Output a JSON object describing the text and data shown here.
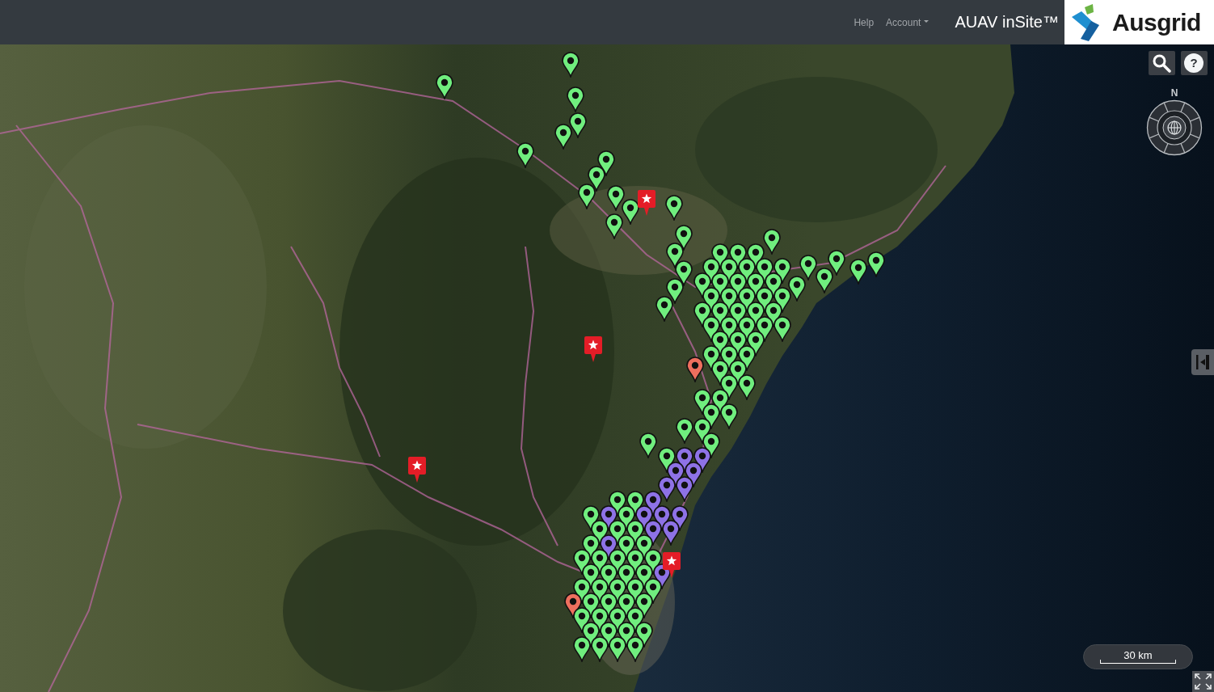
{
  "header": {
    "nav": [
      {
        "label": "Help",
        "kind": "link"
      },
      {
        "label": "Account",
        "kind": "dropdown"
      }
    ],
    "title": "AUAV inSite™",
    "logo": {
      "text": "Ausgrid"
    }
  },
  "map_controls": {
    "help_button": {
      "label": "?"
    },
    "compass": {
      "north_label": "N"
    },
    "scale_bar": {
      "label": "30 km"
    }
  },
  "map": {
    "markers": [
      {
        "kind": "pin",
        "color": "#8e72e6"
      },
      {
        "kind": "pin",
        "color": "#8e72e6"
      },
      {
        "kind": "pin",
        "color": "#8e72e6"
      },
      {
        "kind": "pin",
        "color": "#8e72e6"
      },
      {
        "kind": "pin",
        "color": "#8e72e6"
      },
      {
        "kind": "pin",
        "color": "#8e72e6"
      },
      {
        "kind": "pin",
        "color": "#8e72e6"
      },
      {
        "kind": "pin",
        "color": "#8e72e6"
      },
      {
        "kind": "pin",
        "color": "#8e72e6"
      },
      {
        "kind": "pin",
        "color": "#8e72e6"
      },
      {
        "kind": "pin",
        "color": "#8e72e6"
      },
      {
        "kind": "pin",
        "color": "#8e72e6"
      },
      {
        "kind": "pin",
        "color": "#8e72e6"
      },
      {
        "kind": "pin",
        "color": "#8e72e6"
      },
      {
        "kind": "pin",
        "color": "#8e72e6"
      },
      {
        "kind": "pin",
        "color": "#70ee7e"
      },
      {
        "kind": "pin",
        "color": "#70ee7e"
      },
      {
        "kind": "pin",
        "color": "#70ee7e"
      },
      {
        "kind": "pin",
        "color": "#70ee7e"
      },
      {
        "kind": "pin",
        "color": "#70ee7e"
      },
      {
        "kind": "pin",
        "color": "#70ee7e"
      },
      {
        "kind": "pin",
        "color": "#70ee7e"
      },
      {
        "kind": "pin",
        "color": "#70ee7e"
      },
      {
        "kind": "pin",
        "color": "#70ee7e"
      },
      {
        "kind": "pin",
        "color": "#70ee7e"
      },
      {
        "kind": "pin",
        "color": "#70ee7e"
      },
      {
        "kind": "pin",
        "color": "#70ee7e"
      },
      {
        "kind": "pin",
        "color": "#70ee7e"
      },
      {
        "kind": "pin",
        "color": "#70ee7e"
      },
      {
        "kind": "pin",
        "color": "#70ee7e"
      },
      {
        "kind": "pin",
        "color": "#70ee7e"
      },
      {
        "kind": "pin",
        "color": "#70ee7e"
      },
      {
        "kind": "pin",
        "color": "#70ee7e"
      },
      {
        "kind": "pin",
        "color": "#70ee7e"
      },
      {
        "kind": "pin",
        "color": "#70ee7e"
      },
      {
        "kind": "pin",
        "color": "#70ee7e"
      },
      {
        "kind": "pin",
        "color": "#70ee7e"
      },
      {
        "kind": "pin",
        "color": "#70ee7e"
      },
      {
        "kind": "pin",
        "color": "#70ee7e"
      },
      {
        "kind": "pin",
        "color": "#70ee7e"
      },
      {
        "kind": "pin",
        "color": "#70ee7e"
      },
      {
        "kind": "pin",
        "color": "#70ee7e"
      },
      {
        "kind": "pin",
        "color": "#70ee7e"
      },
      {
        "kind": "pin",
        "color": "#70ee7e"
      },
      {
        "kind": "pin",
        "color": "#70ee7e"
      },
      {
        "kind": "pin",
        "color": "#70ee7e"
      },
      {
        "kind": "pin",
        "color": "#70ee7e"
      },
      {
        "kind": "pin",
        "color": "#70ee7e"
      },
      {
        "kind": "pin",
        "color": "#70ee7e"
      },
      {
        "kind": "pin",
        "color": "#70ee7e"
      },
      {
        "kind": "pin",
        "color": "#70ee7e"
      },
      {
        "kind": "pin",
        "color": "#70ee7e"
      },
      {
        "kind": "pin",
        "color": "#70ee7e"
      },
      {
        "kind": "pin",
        "color": "#70ee7e"
      },
      {
        "kind": "pin",
        "color": "#70ee7e"
      },
      {
        "kind": "pin",
        "color": "#70ee7e"
      },
      {
        "kind": "pin",
        "color": "#70ee7e"
      },
      {
        "kind": "pin",
        "color": "#70ee7e"
      },
      {
        "kind": "pin",
        "color": "#70ee7e"
      },
      {
        "kind": "pin",
        "color": "#70ee7e"
      },
      {
        "kind": "pin",
        "color": "#70ee7e"
      },
      {
        "kind": "pin",
        "color": "#70ee7e"
      },
      {
        "kind": "pin",
        "color": "#70ee7e"
      },
      {
        "kind": "pin",
        "color": "#70ee7e"
      },
      {
        "kind": "pin",
        "color": "#70ee7e"
      },
      {
        "kind": "pin",
        "color": "#70ee7e"
      },
      {
        "kind": "pin",
        "color": "#70ee7e"
      },
      {
        "kind": "pin",
        "color": "#70ee7e"
      },
      {
        "kind": "pin",
        "color": "#70ee7e"
      },
      {
        "kind": "pin",
        "color": "#70ee7e"
      },
      {
        "kind": "pin",
        "color": "#70ee7e"
      },
      {
        "kind": "pin",
        "color": "#70ee7e"
      },
      {
        "kind": "pin",
        "color": "#70ee7e"
      },
      {
        "kind": "pin",
        "color": "#70ee7e"
      },
      {
        "kind": "pin",
        "color": "#70ee7e"
      },
      {
        "kind": "pin",
        "color": "#70ee7e"
      },
      {
        "kind": "pin",
        "color": "#70ee7e"
      },
      {
        "kind": "pin",
        "color": "#70ee7e"
      },
      {
        "kind": "pin",
        "color": "#70ee7e"
      },
      {
        "kind": "pin",
        "color": "#70ee7e"
      },
      {
        "kind": "pin",
        "color": "#70ee7e"
      },
      {
        "kind": "pin",
        "color": "#70ee7e"
      },
      {
        "kind": "pin",
        "color": "#70ee7e"
      },
      {
        "kind": "pin",
        "color": "#70ee7e"
      },
      {
        "kind": "pin",
        "color": "#70ee7e"
      },
      {
        "kind": "pin",
        "color": "#70ee7e"
      },
      {
        "kind": "pin",
        "color": "#70ee7e"
      },
      {
        "kind": "pin",
        "color": "#70ee7e"
      },
      {
        "kind": "pin",
        "color": "#70ee7e"
      },
      {
        "kind": "pin",
        "color": "#70ee7e"
      },
      {
        "kind": "pin",
        "color": "#70ee7e"
      },
      {
        "kind": "pin",
        "color": "#70ee7e"
      },
      {
        "kind": "pin",
        "color": "#70ee7e"
      },
      {
        "kind": "pin",
        "color": "#70ee7e"
      },
      {
        "kind": "pin",
        "color": "#70ee7e"
      },
      {
        "kind": "pin",
        "color": "#70ee7e"
      },
      {
        "kind": "pin",
        "color": "#70ee7e"
      },
      {
        "kind": "pin",
        "color": "#70ee7e"
      },
      {
        "kind": "pin",
        "color": "#70ee7e"
      },
      {
        "kind": "pin",
        "color": "#70ee7e"
      },
      {
        "kind": "pin",
        "color": "#70ee7e"
      },
      {
        "kind": "pin",
        "color": "#70ee7e"
      },
      {
        "kind": "pin",
        "color": "#70ee7e"
      },
      {
        "kind": "pin",
        "color": "#70ee7e"
      },
      {
        "kind": "pin",
        "color": "#70ee7e"
      },
      {
        "kind": "pin",
        "color": "#70ee7e"
      },
      {
        "kind": "pin",
        "color": "#70ee7e"
      },
      {
        "kind": "pin",
        "color": "#70ee7e"
      },
      {
        "kind": "pin",
        "color": "#70ee7e"
      },
      {
        "kind": "pin",
        "color": "#70ee7e"
      },
      {
        "kind": "pin",
        "color": "#70ee7e"
      },
      {
        "kind": "pin",
        "color": "#70ee7e"
      },
      {
        "kind": "pin",
        "color": "#70ee7e"
      },
      {
        "kind": "pin",
        "color": "#70ee7e"
      },
      {
        "kind": "pin",
        "color": "#70ee7e"
      },
      {
        "kind": "pin",
        "color": "#70ee7e"
      },
      {
        "kind": "pin",
        "color": "#70ee7e"
      },
      {
        "kind": "pin",
        "color": "#70ee7e"
      },
      {
        "kind": "pin",
        "color": "#70ee7e"
      },
      {
        "kind": "pin",
        "color": "#70ee7e"
      },
      {
        "kind": "pin",
        "color": "#70ee7e"
      },
      {
        "kind": "pin",
        "color": "#70ee7e"
      },
      {
        "kind": "pin",
        "color": "#70ee7e"
      },
      {
        "kind": "pin",
        "color": "#70ee7e"
      },
      {
        "kind": "pin",
        "color": "#70ee7e"
      },
      {
        "kind": "pin",
        "color": "#70ee7e"
      },
      {
        "kind": "pin",
        "color": "#70ee7e"
      },
      {
        "kind": "pin",
        "color": "#ee6f5e"
      },
      {
        "kind": "pin",
        "color": "#ee6f5e"
      },
      {
        "kind": "star",
        "color": "#e41d27"
      },
      {
        "kind": "star",
        "color": "#e41d27"
      },
      {
        "kind": "star",
        "color": "#e41d27"
      },
      {
        "kind": "star",
        "color": "#e41d27"
      }
    ]
  }
}
